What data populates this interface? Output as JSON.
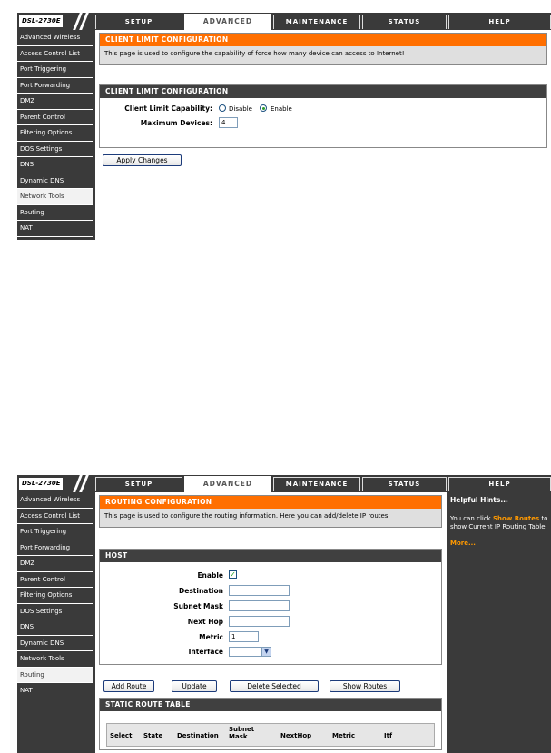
{
  "brand": "DSL-2730E",
  "tabs": [
    "SETUP",
    "ADVANCED",
    "MAINTENANCE",
    "STATUS",
    "HELP"
  ],
  "active_tab": "ADVANCED",
  "sidebar": [
    "Advanced Wireless",
    "Access Control List",
    "Port Triggering",
    "Port Forwarding",
    "DMZ",
    "Parent Control",
    "Filtering Options",
    "DOS Settings",
    "DNS",
    "Dynamic DNS",
    "Network Tools",
    "Routing",
    "NAT"
  ],
  "screen1": {
    "selected_sidebar": "Network Tools",
    "header_title": "CLIENT LIMIT CONFIGURATION",
    "header_desc": "This page is used to configure the capability of force how many device can access to Internet!",
    "section_title": "CLIENT LIMIT CONFIGURATION",
    "capability_label": "Client Limit Capability:",
    "disable_label": "Disable",
    "enable_label": "Enable",
    "capability_value": "Enable",
    "max_devices_label": "Maximum Devices:",
    "max_devices_value": "4",
    "apply_button": "Apply Changes"
  },
  "screen2": {
    "selected_sidebar": "Routing",
    "header_title": "ROUTING CONFIGURATION",
    "header_desc": "This page is used to configure the routing information. Here you can add/delete IP routes.",
    "section_title": "HOST",
    "enable_label": "Enable",
    "enable_checked": true,
    "destination_label": "Destination",
    "destination_value": "",
    "subnet_label": "Subnet Mask",
    "subnet_value": "",
    "nexthop_label": "Next Hop",
    "nexthop_value": "",
    "metric_label": "Metric",
    "metric_value": "1",
    "interface_label": "Interface",
    "interface_value": "",
    "buttons": {
      "add": "Add Route",
      "update": "Update",
      "delete": "Delete Selected",
      "show": "Show Routes"
    },
    "table_title": "STATIC ROUTE TABLE",
    "table_headers": [
      "Select",
      "State",
      "Destination",
      "Subnet Mask",
      "NextHop",
      "Metric",
      "Itf"
    ],
    "hints": {
      "title": "Helpful Hints...",
      "text_before": "You can click",
      "link": "Show Routes",
      "text_after": "to show Current IP Routing Table.",
      "more": "More..."
    }
  }
}
